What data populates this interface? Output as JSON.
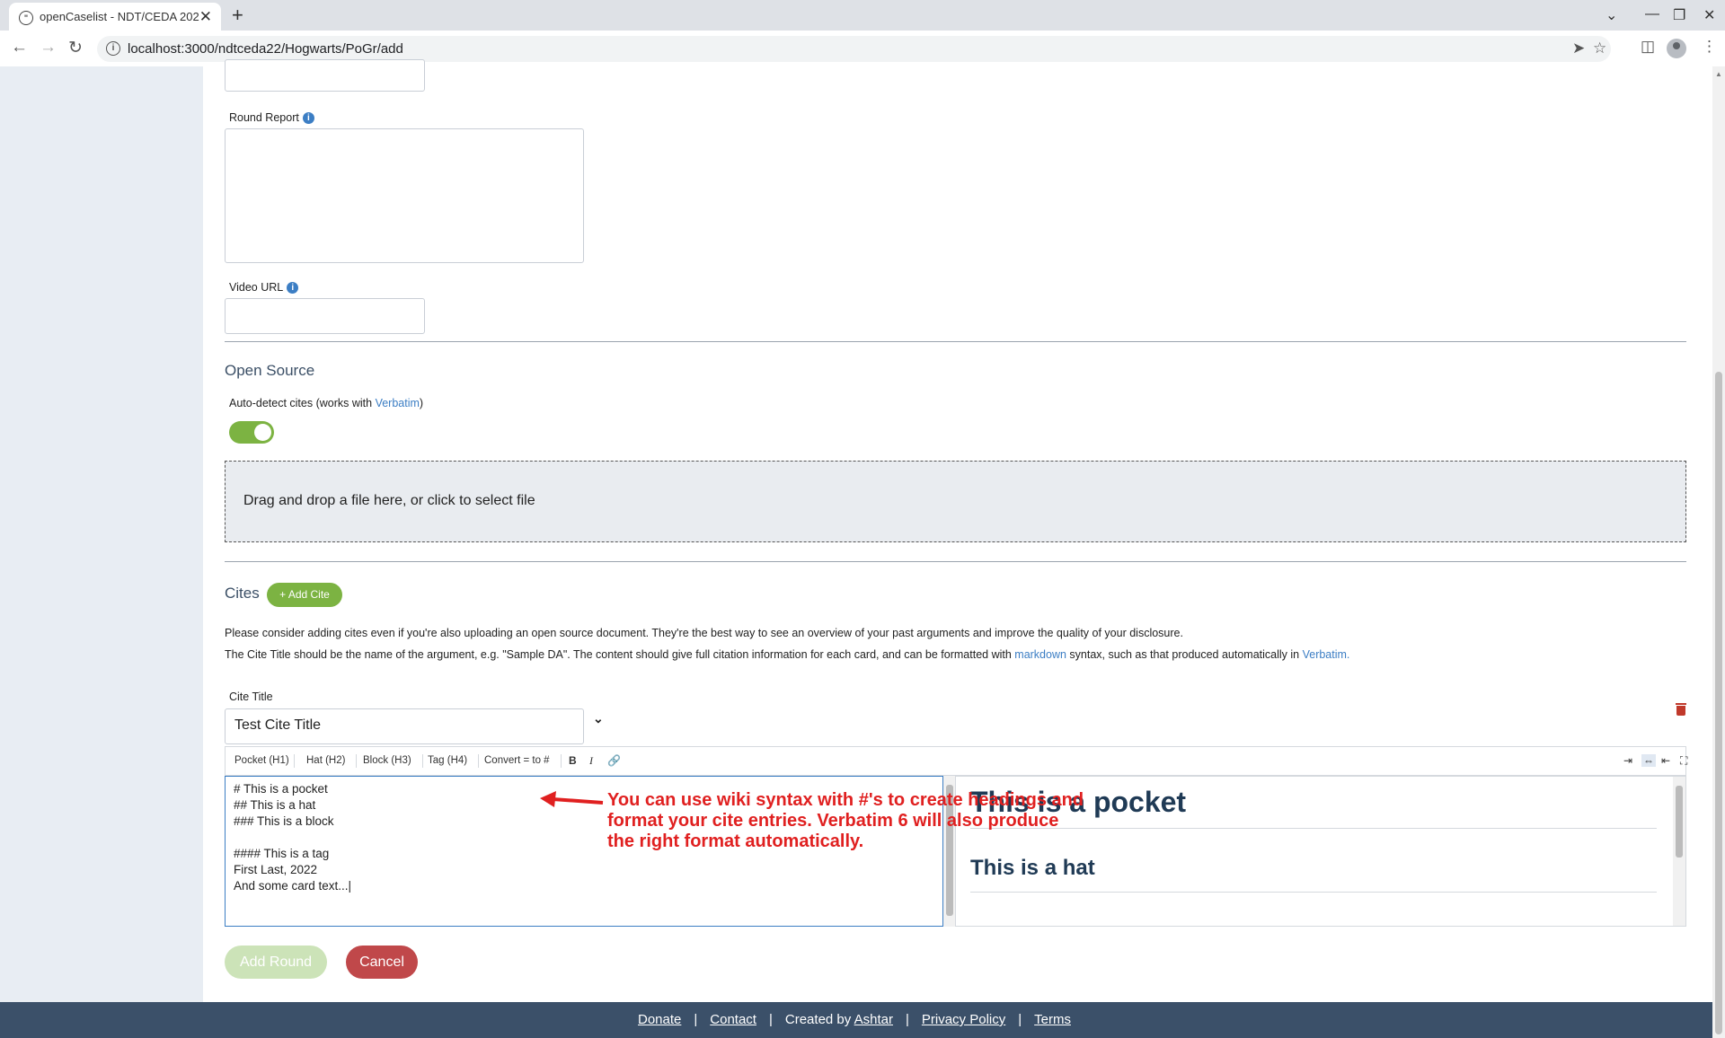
{
  "browser": {
    "tab_title": "openCaselist - NDT/CEDA 202",
    "url": "localhost:3000/ndtceda22/Hogwarts/PoGr/add",
    "new_tab": "+",
    "tab_close": "✕",
    "win_minimize": "—",
    "win_restore": "❐",
    "win_close": "✕",
    "win_dropdown": "⌄"
  },
  "form": {
    "round_report_label": "Round Report",
    "video_url_label": "Video URL",
    "info_glyph": "i"
  },
  "open_source": {
    "title": "Open Source",
    "autodetect_prefix": "Auto-detect cites (works with ",
    "autodetect_link": "Verbatim",
    "autodetect_suffix": ")",
    "toggle_on": true,
    "dropzone_text": "Drag and drop a file here, or click to select file"
  },
  "cites": {
    "title": "Cites",
    "add_cite_label": "+ Add Cite",
    "para1": "Please consider adding cites even if you're also uploading an open source document. They're the best way to see an overview of your past arguments and improve the quality of your disclosure.",
    "para2_prefix": "The Cite Title should be the name of the argument, e.g. \"Sample DA\". The content should give full citation information for each card, and can be formatted with ",
    "para2_link1": "markdown",
    "para2_mid": " syntax, such as that produced automatically in ",
    "para2_link2": "Verbatim.",
    "cite_title_label": "Cite Title",
    "cite_title_value": "Test Cite Title"
  },
  "editor": {
    "toolbar": [
      "Pocket (H1)",
      "Hat (H2)",
      "Block (H3)",
      "Tag (H4)",
      "Convert = to #"
    ],
    "bold": "B",
    "italic": "I",
    "lines": [
      "# This is a pocket",
      "## This is a hat",
      "### This is a block",
      "",
      "#### This is a tag",
      "First Last, 2022",
      "And some card text...|"
    ],
    "preview_h1": "This is a pocket",
    "preview_h2": "This is a hat"
  },
  "annotation": {
    "line1": "You can use wiki syntax with #'s to create headings and",
    "line2": "format your cite entries. Verbatim 6 will also produce",
    "line3": "the right format automatically."
  },
  "actions": {
    "add_round": "Add Round",
    "cancel": "Cancel"
  },
  "footer": {
    "donate": "Donate",
    "contact": "Contact",
    "created_by": "Created by ",
    "author": "Ashtar",
    "privacy": "Privacy Policy",
    "terms": "Terms",
    "sep": "|"
  },
  "colors": {
    "accent_green": "#7cb342",
    "link_blue": "#3c7ec4",
    "cancel_red": "#c0484a",
    "footer_bg": "#3b5069",
    "annotation_red": "#e02020"
  }
}
